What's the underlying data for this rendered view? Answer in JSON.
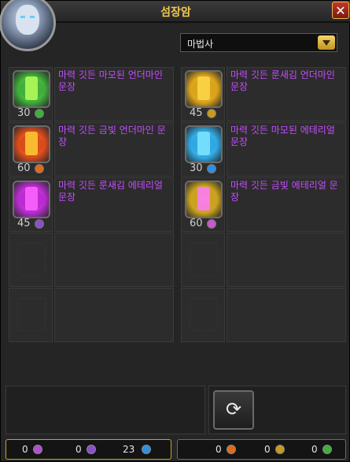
{
  "window": {
    "title": "섬장암",
    "close_label": "✕"
  },
  "class_select": {
    "selected": "마법사"
  },
  "items": [
    {
      "name": "마력 깃든 마모된 언더마인 문장",
      "qty": "30",
      "gem_color": "#3fae3a",
      "accent": "#b9ff5a",
      "currency_color": "#3fae3a"
    },
    {
      "name": "마력 깃든 룬새김 언더마인 문장",
      "qty": "45",
      "gem_color": "#d9a21b",
      "accent": "#ffd84a",
      "currency_color": "#c99a1a"
    },
    {
      "name": "마력 깃든 금빛 언더마인 문장",
      "qty": "60",
      "gem_color": "#d94a1b",
      "accent": "#ffcc33",
      "currency_color": "#e06a1a"
    },
    {
      "name": "마력 깃든 마모된 에테리얼 문장",
      "qty": "30",
      "gem_color": "#2fa7e0",
      "accent": "#7fe8ff",
      "currency_color": "#2f8fe0"
    },
    {
      "name": "마력 깃든 룬새김 에테리얼 문장",
      "qty": "45",
      "gem_color": "#b82bd0",
      "accent": "#ff66ff",
      "currency_color": "#8a4fc9"
    },
    {
      "name": "마력 깃든 금빛 에테리얼 문장",
      "qty": "60",
      "gem_color": "#c9a21b",
      "accent": "#ff7aff",
      "currency_color": "#c95acb"
    }
  ],
  "empty_slots": 4,
  "refresh_button": {
    "icon": "refresh-icon",
    "glyph": "⟳"
  },
  "currency_left": [
    {
      "value": "0",
      "color": "#b04fd0"
    },
    {
      "value": "0",
      "color": "#8a4fc9"
    },
    {
      "value": "23",
      "color": "#2f8fe0"
    }
  ],
  "currency_right": [
    {
      "value": "0",
      "color": "#e06a1a"
    },
    {
      "value": "0",
      "color": "#c99a1a"
    },
    {
      "value": "0",
      "color": "#3fae3a"
    }
  ]
}
